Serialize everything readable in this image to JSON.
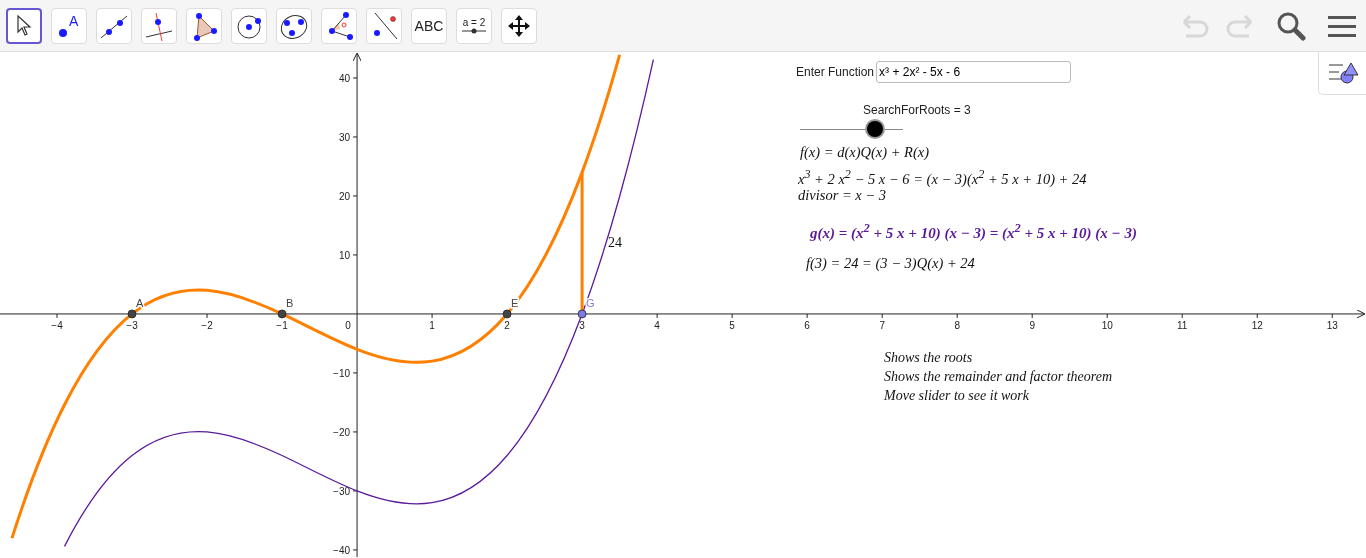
{
  "toolbar": {
    "tools": [
      {
        "kind": "move",
        "selected": true
      },
      {
        "kind": "point",
        "label": "A",
        "selected": false
      },
      {
        "kind": "line",
        "selected": false
      },
      {
        "kind": "perpendicular",
        "selected": false
      },
      {
        "kind": "polygon",
        "selected": false
      },
      {
        "kind": "circle",
        "selected": false
      },
      {
        "kind": "conic",
        "selected": false
      },
      {
        "kind": "angle",
        "selected": false
      },
      {
        "kind": "reflect",
        "selected": false
      },
      {
        "kind": "text",
        "label": "ABC",
        "selected": false
      },
      {
        "kind": "slider",
        "label": "a = 2",
        "selected": false
      },
      {
        "kind": "pan",
        "selected": false
      }
    ],
    "actions": [
      {
        "kind": "undo",
        "disabled": true
      },
      {
        "kind": "redo",
        "disabled": true
      },
      {
        "kind": "search",
        "disabled": false
      },
      {
        "kind": "menu",
        "disabled": false
      }
    ]
  },
  "graphics": {
    "chart_data": {
      "type": "line",
      "xlim": [
        -4.76,
        13.45
      ],
      "ylim": [
        -41.2,
        44.4
      ],
      "xticks": [
        -4,
        -3,
        -2,
        -1,
        1,
        2,
        3,
        4,
        5,
        6,
        7,
        8,
        9,
        10,
        11,
        12,
        13
      ],
      "yticks": [
        -40,
        -30,
        -20,
        -10,
        10,
        20,
        30,
        40
      ],
      "x": [
        -4.6,
        -3.9,
        -3,
        -2,
        -1,
        0,
        1,
        2,
        3,
        3.5,
        3.95
      ],
      "series": [
        {
          "color": "#ff7f00",
          "values": [
            -38,
            -15.4,
            0,
            4,
            0,
            -6,
            -8,
            0,
            24,
            43.9,
            null
          ]
        },
        {
          "color": "#5a1a9a",
          "values": [
            null,
            -39.4,
            -24,
            -20,
            -24,
            -30,
            -32,
            -24,
            0,
            19.9,
            43.1
          ]
        }
      ]
    },
    "origin_label": "0",
    "points": [
      {
        "label": "A",
        "color": "#444444"
      },
      {
        "label": "B",
        "color": "#444444"
      },
      {
        "label": "E",
        "color": "#444444"
      },
      {
        "label": "G",
        "color": "#7c7ce0"
      }
    ],
    "remainder": {
      "label": "24"
    },
    "input": {
      "label": "Enter Function",
      "value": "x³ + 2x² - 5x - 6"
    },
    "slider": {
      "caption": "SearchForRoots = 3",
      "level": 0.73
    },
    "formulas": [
      {
        "kind": "plain",
        "text": "f(x) = d(x)Q(x) + R(x)"
      },
      {
        "kind": "plain",
        "text": "x$^{3}$ + 2 x$^{2}$ − 5 x − 6 = (x − 3)(x$^{2}$ + 5 x + 10) + 24"
      },
      {
        "kind": "plain",
        "text": "divisor = x − 3"
      },
      {
        "kind": "highlight",
        "text": "g(x) = (x$^{2}$ + 5 x + 10)  (x − 3) = (x$^{2}$ + 5 x + 10)  (x − 3)"
      },
      {
        "kind": "plain",
        "text": "f(3) = 24 = (3 − 3)Q(x) + 24"
      }
    ],
    "notes": [
      "Shows the roots",
      "Shows the remainder and factor theorem",
      "Move slider to see it work"
    ]
  }
}
